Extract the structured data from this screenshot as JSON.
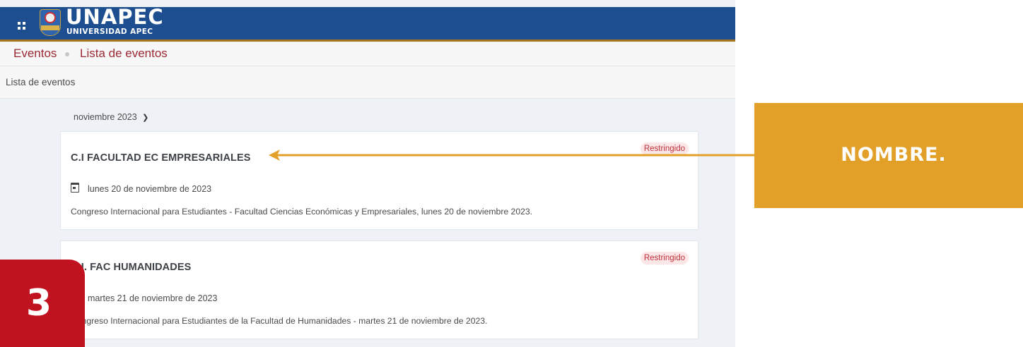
{
  "header": {
    "menu_icon": "grid-icon",
    "logo_text": "UNAPEC",
    "logo_subtext": "UNIVERSIDAD APEC",
    "brand_color": "#1d4e8f",
    "accent_color": "#a8751f"
  },
  "breadcrumb": [
    "Eventos",
    "Lista de eventos"
  ],
  "page_title": "Lista de eventos",
  "month_filter": {
    "value": "noviembre 2023",
    "icon": "chevron-down-icon"
  },
  "events": [
    {
      "title": "C.I FACULTAD EC EMPRESARIALES",
      "badge": "Restringido",
      "date": "lunes 20 de noviembre de 2023",
      "description": "Congreso Internacional para Estudiantes - Facultad Ciencias Económicas y Empresariales, lunes 20 de noviembre 2023."
    },
    {
      "title": "C.I. FAC HUMANIDADES",
      "badge": "Restringido",
      "date": "martes 21 de noviembre de 2023",
      "description": "Congreso Internacional para Estudiantes de la Facultad de Humanidades - martes 21 de noviembre de 2023."
    }
  ],
  "annotations": {
    "callout_label": "NOMBRE.",
    "callout_color": "#e2a028",
    "step_number": "3",
    "step_color": "#c1121f"
  }
}
